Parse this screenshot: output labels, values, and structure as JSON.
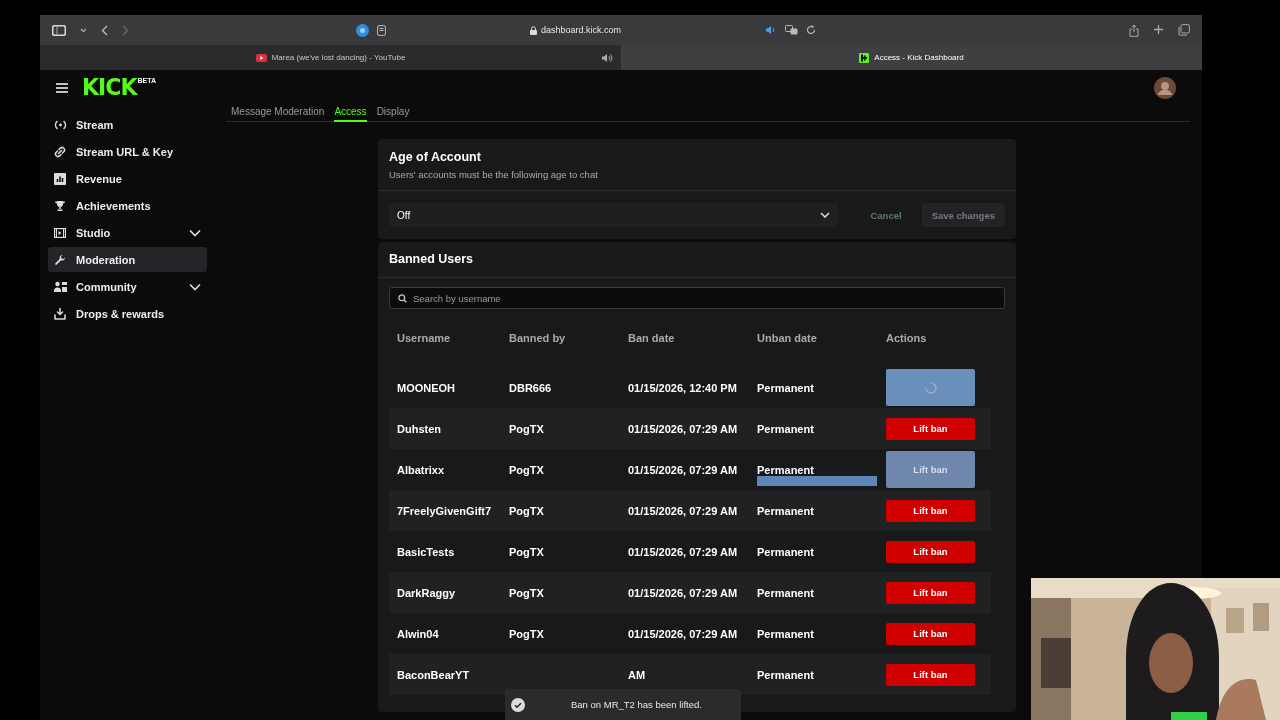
{
  "browser": {
    "address": "dashboard.kick.com",
    "tabs": [
      {
        "title": "Marea (we've lost dancing) - YouTube",
        "selected": false,
        "playing_audio": true
      },
      {
        "title": "Access - Kick Dashboard",
        "selected": true,
        "playing_audio": false
      }
    ]
  },
  "header": {
    "logo": "KICK",
    "logo_badge": "BETA"
  },
  "sidebar": {
    "items": [
      {
        "label": "Stream",
        "selected": false
      },
      {
        "label": "Stream URL & Key",
        "selected": false
      },
      {
        "label": "Revenue",
        "selected": false
      },
      {
        "label": "Achievements",
        "selected": false
      },
      {
        "label": "Studio",
        "selected": false,
        "expanded": false
      },
      {
        "label": "Moderation",
        "selected": true
      },
      {
        "label": "Community",
        "selected": false,
        "expanded": false
      },
      {
        "label": "Drops & rewards",
        "selected": false
      }
    ]
  },
  "settings_tabs": [
    {
      "label": "Message Moderation",
      "selected": false
    },
    {
      "label": "Access",
      "selected": true
    },
    {
      "label": "Display",
      "selected": false
    }
  ],
  "age_card": {
    "title": "Age of Account",
    "description": "Users' accounts must be the following age to chat",
    "select_value": "Off",
    "buttons": [
      {
        "label": "Cancel",
        "disabled": true,
        "kind": "ghost"
      },
      {
        "label": "Save changes",
        "disabled": true,
        "kind": "filled"
      }
    ]
  },
  "banned_card": {
    "title": "Banned Users",
    "search_placeholder": "Search by username",
    "columns": [
      "Username",
      "Banned by",
      "Ban date",
      "Unban date",
      "Actions"
    ],
    "rows": [
      {
        "username": "MOONEOH",
        "banned_by": "DBR666",
        "ban_date": "01/15/2026, 12:40 PM",
        "unban_date": "Permanent",
        "action": {
          "loading": true
        }
      },
      {
        "username": "Duhsten",
        "banned_by": "PogTX",
        "ban_date": "01/15/2026, 07:29 AM",
        "unban_date": "Permanent",
        "action": {
          "label": "Lift ban",
          "loading": false,
          "disabled": false
        }
      },
      {
        "username": "Albatrixx",
        "banned_by": "PogTX",
        "ban_date": "01/15/2026, 07:29 AM",
        "unban_date": "Permanent",
        "action": {
          "label": "Lift ban",
          "loading": false,
          "disabled": true
        }
      },
      {
        "username": "7FreelyGivenGift7",
        "banned_by": "PogTX",
        "ban_date": "01/15/2026, 07:29 AM",
        "unban_date": "Permanent",
        "action": {
          "label": "Lift ban",
          "loading": false,
          "disabled": false
        }
      },
      {
        "username": "BasicTests",
        "banned_by": "PogTX",
        "ban_date": "01/15/2026, 07:29 AM",
        "unban_date": "Permanent",
        "action": {
          "label": "Lift ban",
          "loading": false,
          "disabled": false
        }
      },
      {
        "username": "DarkRaggy",
        "banned_by": "PogTX",
        "ban_date": "01/15/2026, 07:29 AM",
        "unban_date": "Permanent",
        "action": {
          "label": "Lift ban",
          "loading": false,
          "disabled": false
        }
      },
      {
        "username": "Alwin04",
        "banned_by": "PogTX",
        "ban_date": "01/15/2026, 07:29 AM",
        "unban_date": "Permanent",
        "action": {
          "label": "Lift ban",
          "loading": false,
          "disabled": false
        }
      },
      {
        "username": "BaconBearYT",
        "ban_date": "AM",
        "unban_date": "Permanent",
        "action": {
          "label": "Lift ban",
          "loading": false,
          "disabled": false
        }
      }
    ]
  },
  "toast": {
    "message": "Ban on MR_T2 has been lifted."
  }
}
